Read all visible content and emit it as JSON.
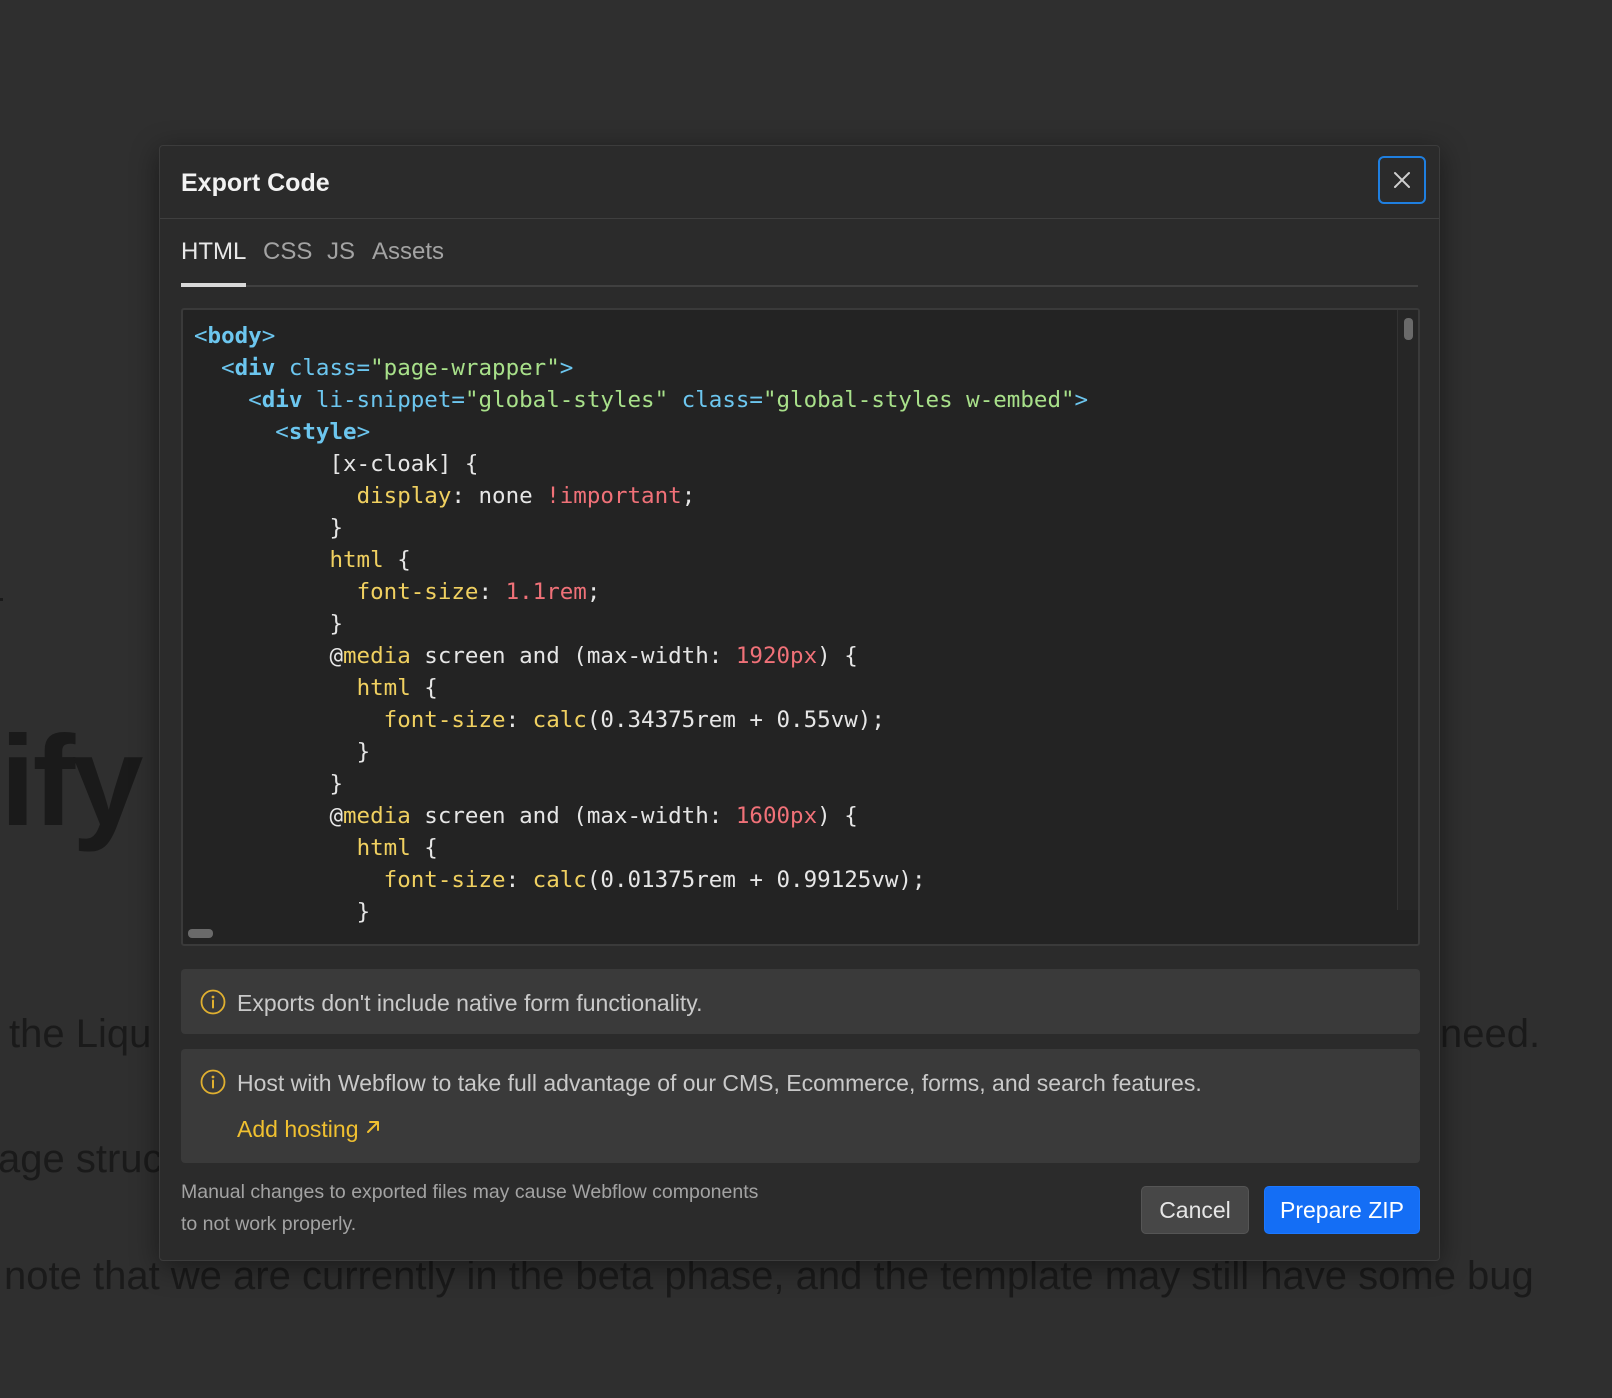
{
  "background": {
    "big_text": "ify",
    "line1_left": "the Liqu",
    "line1_right": "need.",
    "line2": "age struc",
    "line3": "note that we are currently in the beta phase, and the template may still have some bug"
  },
  "modal": {
    "title": "Export Code",
    "close_icon": "close-icon",
    "tabs": [
      {
        "label": "HTML",
        "active": true
      },
      {
        "label": "CSS",
        "active": false
      },
      {
        "label": "JS",
        "active": false
      },
      {
        "label": "Assets",
        "active": false
      }
    ],
    "code": {
      "b_lt": "<",
      "b_tag": "body",
      "b_gt": ">",
      "d1_lt": "<",
      "d1_tag": "div",
      "d1_attr": " class=",
      "d1_val": "\"page-wrapper\"",
      "d1_gt": ">",
      "d2_lt": "<",
      "d2_tag": "div",
      "d2_attr1": " li-snippet=",
      "d2_val1": "\"global-styles\"",
      "d2_attr2": " class=",
      "d2_val2": "\"global-styles w-embed\"",
      "d2_gt": ">",
      "s_lt": "<",
      "s_tag": "style",
      "s_gt": ">",
      "l5": "[x-cloak] {",
      "l6_prop": "display",
      "l6_colon": ": none ",
      "l6_imp": "!important",
      "l6_semi": ";",
      "l7": "}",
      "l8_sel": "html",
      "l8_brace": " {",
      "l9_prop": "font-size",
      "l9_colon": ": ",
      "l9_val": "1.1rem",
      "l9_semi": ";",
      "l10": "}",
      "l11_at": "@",
      "l11_media": "media",
      "l11_mid": " screen and (max-width: ",
      "l11_num": "1920px",
      "l11_end": ") {",
      "l12_sel": "html",
      "l12_brace": " {",
      "l13_prop": "font-size",
      "l13_colon": ": ",
      "l13_fn": "calc",
      "l13_args": "(0.34375rem + 0.55vw);",
      "l14": "}",
      "l15": "}",
      "l16_at": "@",
      "l16_media": "media",
      "l16_mid": " screen and (max-width: ",
      "l16_num": "1600px",
      "l16_end": ") {",
      "l17_sel": "html",
      "l17_brace": " {",
      "l18_prop": "font-size",
      "l18_colon": ": ",
      "l18_fn": "calc",
      "l18_args": "(0.01375rem + 0.99125vw);",
      "l19": "}"
    },
    "notices": [
      {
        "icon": "info-icon",
        "text": "Exports don't include native form functionality."
      },
      {
        "icon": "info-icon",
        "text": "Host with Webflow to take full advantage of our CMS, Ecommerce, forms, and search features.",
        "link_label": "Add hosting",
        "link_icon": "arrow-up-right-icon"
      }
    ],
    "footer_note_line1": "Manual changes to exported files may cause Webflow components",
    "footer_note_line2": "to not work properly.",
    "cancel_label": "Cancel",
    "primary_label": "Prepare ZIP"
  },
  "colors": {
    "accent": "#146ef5",
    "link": "#f0c030",
    "close_border": "#1f7fe0"
  }
}
